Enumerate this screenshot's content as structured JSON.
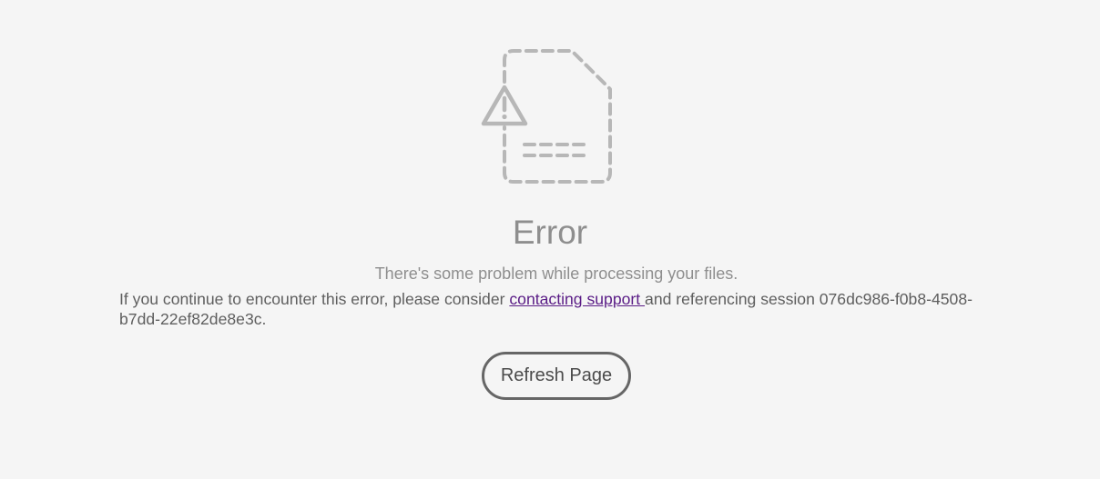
{
  "error": {
    "icon": "file-warning-icon",
    "title": "Error",
    "subtitle": "There's some problem while processing your files.",
    "detail_prefix": "If you continue to encounter this error, please consider ",
    "support_link_label": "contacting support ",
    "detail_suffix": "and referencing session 076dc986-f0b8-4508-b7dd-22ef82de8e3c."
  },
  "actions": {
    "refresh_label": "Refresh Page"
  },
  "colors": {
    "background": "#f5f5f5",
    "text_muted": "#8e8e8e",
    "text_body": "#5e5e5e",
    "link": "#5a1c86",
    "icon": "#b7b7b7",
    "button_border": "#666666"
  }
}
